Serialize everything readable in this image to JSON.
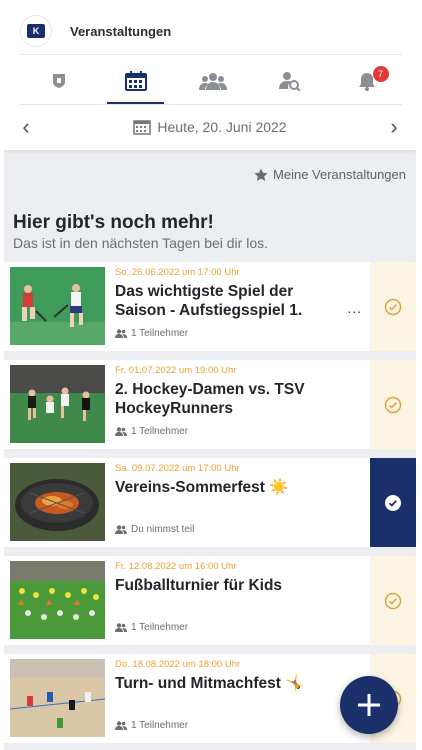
{
  "app": {
    "title": "Veranstaltungen",
    "logo_letter": "K"
  },
  "tabs": [
    {
      "name": "club-icon",
      "active": false
    },
    {
      "name": "calendar-icon",
      "active": true
    },
    {
      "name": "group-icon",
      "active": false
    },
    {
      "name": "user-search-icon",
      "active": false
    },
    {
      "name": "bell-icon",
      "active": false,
      "badge": "7"
    }
  ],
  "datebar": {
    "label": "Heute, 20. Juni 2022",
    "prev": "‹",
    "next": "›"
  },
  "filter": {
    "label": "Meine Veranstaltungen"
  },
  "section": {
    "heading": "Hier gibt's noch mehr!",
    "subheading": "Das ist in den nächsten Tagen bei dir los."
  },
  "events": [
    {
      "date": "So. 26.06.2022 um 17:00 Uhr",
      "title": "Das wichtigste Spiel der",
      "title2": "Saison - Aufstiegsspiel 1.",
      "meta": "1 Teilnehmer",
      "status": "interested",
      "more": "..."
    },
    {
      "date": "Fr. 01.07.2022 um 19:00 Uhr",
      "title": "2. Hockey-Damen vs. TSV",
      "title2": "HockeyRunners",
      "meta": "1 Teilnehmer",
      "status": "interested"
    },
    {
      "date": "Sa. 09.07.2022 um 17:00 Uhr",
      "title": "Vereins-Sommerfest ☀️",
      "title2": "",
      "meta": "Du nimmst teil",
      "status": "joined"
    },
    {
      "date": "Fr. 12.08.2022 um 16:00 Uhr",
      "title": "Fußballturnier für Kids",
      "title2": "",
      "meta": "1 Teilnehmer",
      "status": "interested"
    },
    {
      "date": "Do. 18.08.2022 um 18:00 Uhr",
      "title": "Turn- und Mitmachfest 🤸",
      "title2": "",
      "meta": "1 Teilnehmer",
      "status": "interested"
    }
  ],
  "colors": {
    "primary": "#1b2f6b",
    "accent": "#f0a030",
    "badge": "#e53935",
    "status_bg": "#fdf5e4"
  }
}
